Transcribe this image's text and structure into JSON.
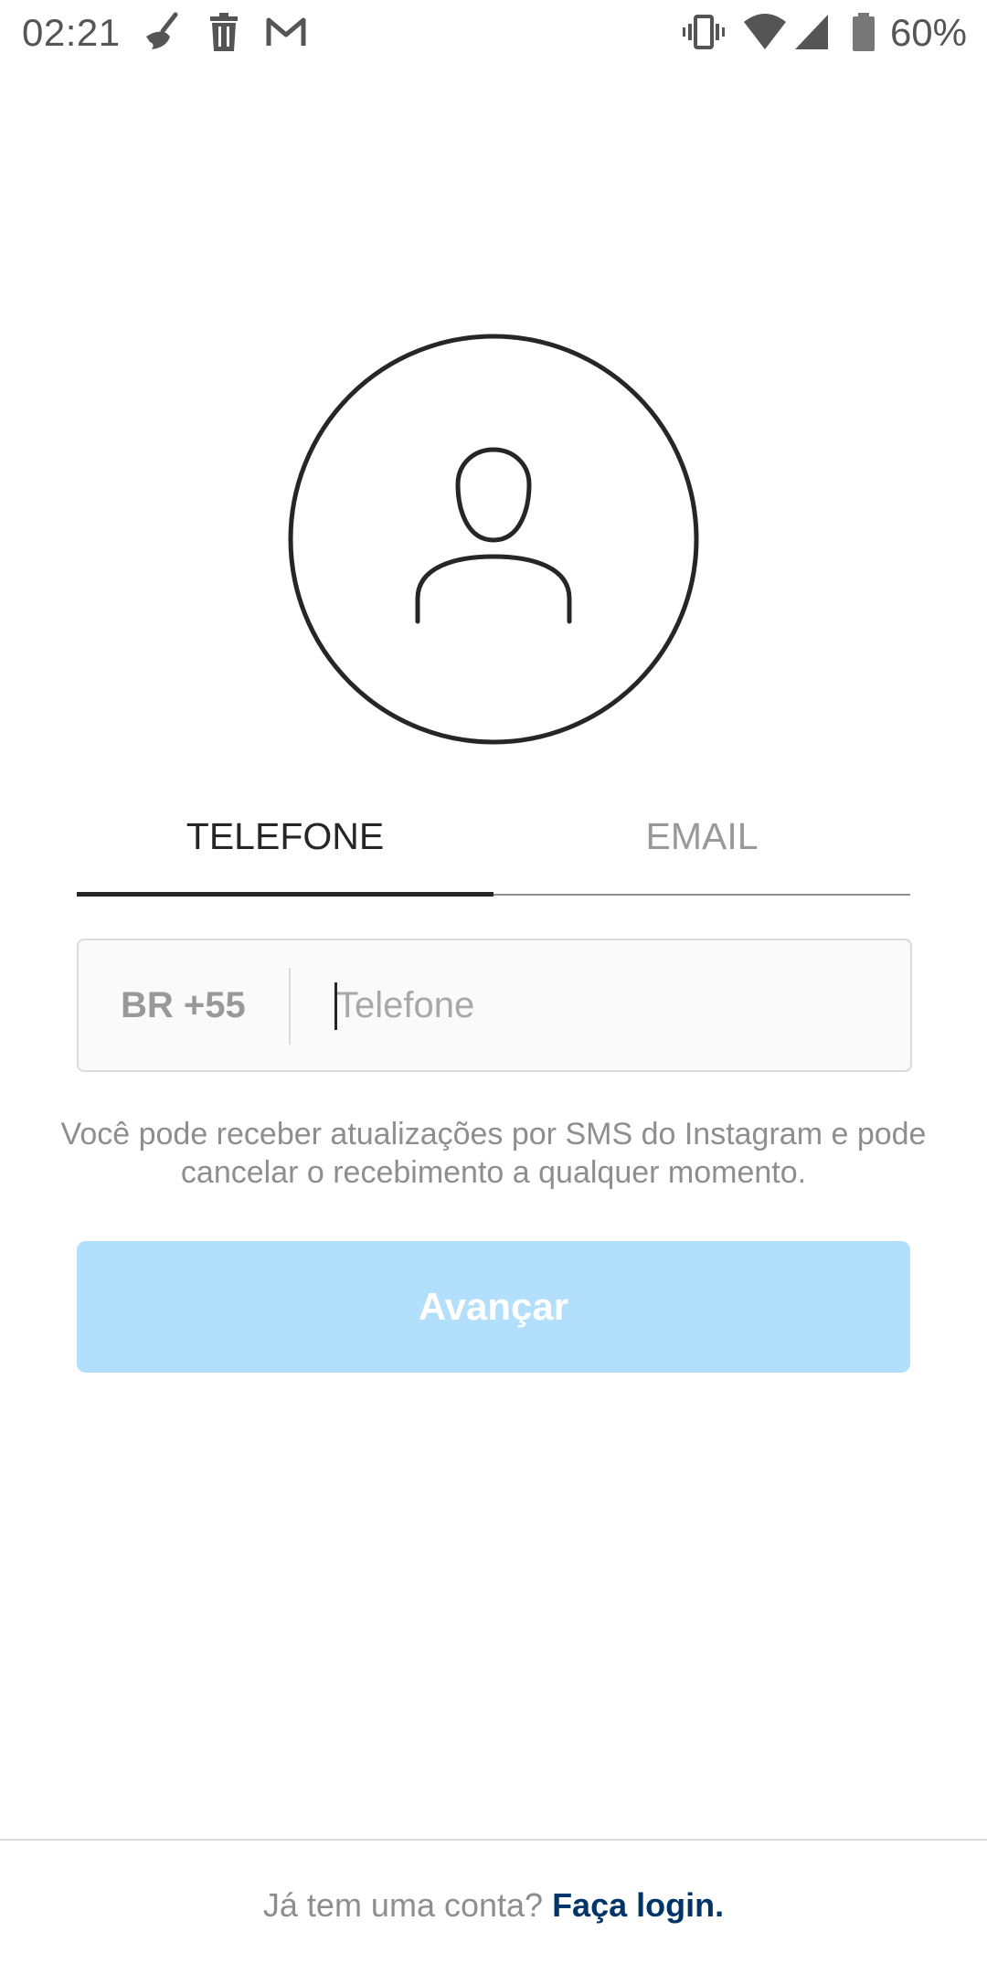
{
  "status_bar": {
    "time": "02:21",
    "battery_percent": "60%",
    "icons": [
      "broom-icon",
      "trash-icon",
      "gmail-icon",
      "vibrate-icon",
      "wifi-icon",
      "signal-icon",
      "battery-icon"
    ]
  },
  "avatar": {
    "icon": "user-silhouette-icon"
  },
  "tabs": [
    {
      "label": "TELEFONE",
      "selected": true
    },
    {
      "label": "EMAIL",
      "selected": false
    }
  ],
  "phone_field": {
    "country_code": "BR +55",
    "placeholder": "Telefone",
    "value": ""
  },
  "notice": "Você pode receber atualizações por SMS do Instagram e pode cancelar o recebimento a qualquer momento.",
  "next_button": {
    "label": "Avançar",
    "enabled": false
  },
  "footer": {
    "prompt": "Já tem uma conta?",
    "login_link": "Faça login."
  },
  "colors": {
    "button_disabled": "#b2dffc",
    "link": "#003569",
    "muted_text": "#8e8e8e"
  }
}
